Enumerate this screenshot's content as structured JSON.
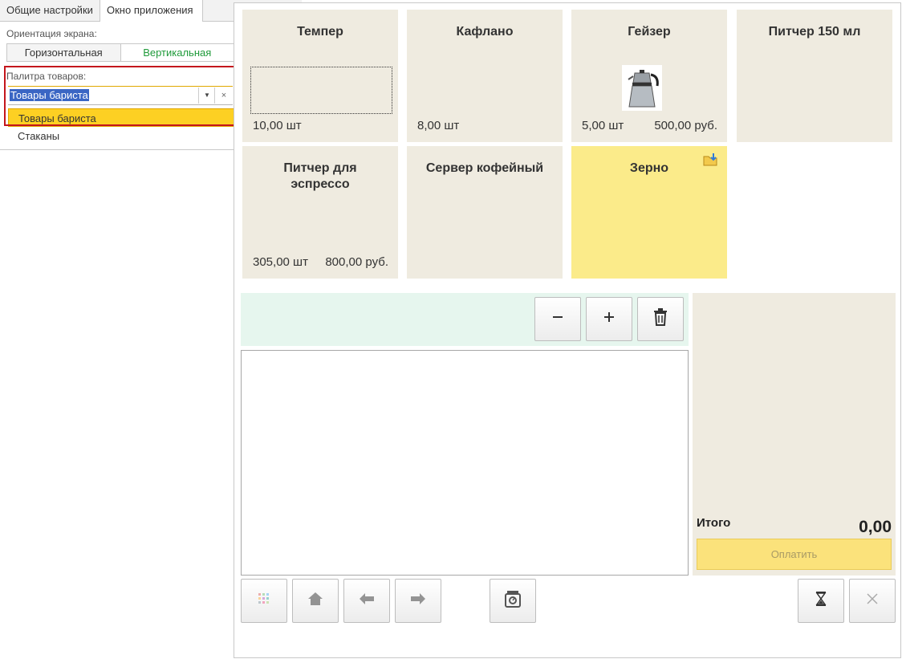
{
  "settings": {
    "tabs": [
      "Общие настройки",
      "Окно приложения"
    ],
    "orientation_label": "Ориентация экрана:",
    "orientation_options": [
      "Горизонтальная",
      "Вертикальная"
    ],
    "palette_label": "Палитра товаров:",
    "palette_value": "Товары бариста",
    "dropdown_options": [
      "Товары бариста",
      "Стаканы"
    ],
    "clear_symbol": "×",
    "dropdown_symbol": "▼"
  },
  "products": [
    {
      "name": "Темпер",
      "qty": "10,00 шт",
      "price": ""
    },
    {
      "name": "Кафлано",
      "qty": "8,00 шт",
      "price": ""
    },
    {
      "name": "Гейзер",
      "qty": "5,00 шт",
      "price": "500,00 руб."
    },
    {
      "name": "Питчер 150 мл",
      "qty": "",
      "price": ""
    },
    {
      "name": "Питчер для эспрессо",
      "qty": "305,00 шт",
      "price": "800,00 руб."
    },
    {
      "name": "Сервер кофейный",
      "qty": "",
      "price": ""
    },
    {
      "name": "Зерно",
      "qty": "",
      "price": ""
    }
  ],
  "totals": {
    "label": "Итого",
    "value": "0,00",
    "pay_label": "Оплатить"
  },
  "colors": {
    "tile_bg": "#efebe0",
    "tile_highlight": "#fbeb8a",
    "selected_option": "#fdd023",
    "active_orientation": "#1f9a3a",
    "toolbar_bg": "#e6f6ee",
    "outline_red": "#c4161c"
  },
  "icons": [
    "minus-icon",
    "plus-icon",
    "trash-icon",
    "grid-icon",
    "home-icon",
    "arrow-left-icon",
    "arrow-right-icon",
    "scale-icon",
    "hourglass-icon",
    "close-icon",
    "folder-icon",
    "geyser-image"
  ]
}
